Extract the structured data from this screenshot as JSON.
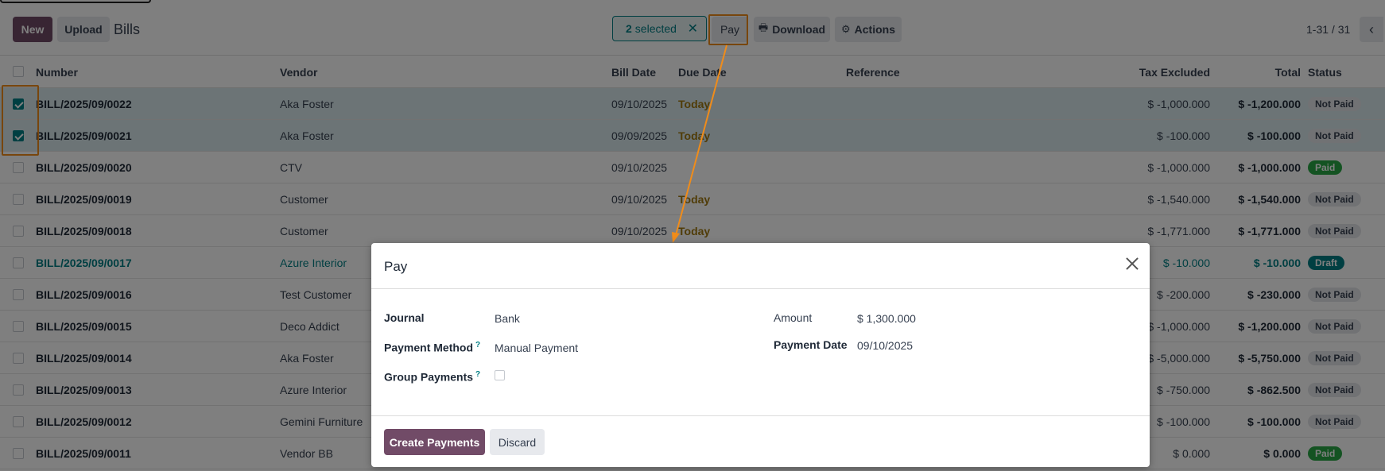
{
  "control_panel": {
    "new_label": "New",
    "upload_label": "Upload",
    "breadcrumb": "Bills",
    "selected_count": "2",
    "selected_text": "selected",
    "clear_icon": "close-icon",
    "pay_label": "Pay",
    "download_label": "Download",
    "download_icon": "printer-icon",
    "actions_label": "Actions",
    "actions_icon": "gear-icon",
    "pager": "1-31 / 31",
    "prev_icon": "chevron-left-icon"
  },
  "table": {
    "columns": [
      "Number",
      "Vendor",
      "Bill Date",
      "Due Date",
      "Reference",
      "Tax Excluded",
      "Total",
      "Status"
    ],
    "rows": [
      {
        "number": "BILL/2025/09/0022",
        "vendor": "Aka Foster",
        "bill_date": "09/10/2025",
        "due": "Today",
        "tax_excluded": "$ -1,000.000",
        "total": "$ -1,200.000",
        "status": "Not Paid",
        "status_type": "notpaid",
        "selected": true
      },
      {
        "number": "BILL/2025/09/0021",
        "vendor": "Aka Foster",
        "bill_date": "09/09/2025",
        "due": "Today",
        "tax_excluded": "$ -100.000",
        "total": "$ -100.000",
        "status": "Not Paid",
        "status_type": "notpaid",
        "selected": true
      },
      {
        "number": "BILL/2025/09/0020",
        "vendor": "CTV",
        "bill_date": "09/10/2025",
        "due": "",
        "tax_excluded": "$ -1,000.000",
        "total": "$ -1,000.000",
        "status": "Paid",
        "status_type": "paid",
        "selected": false
      },
      {
        "number": "BILL/2025/09/0019",
        "vendor": "Customer",
        "bill_date": "09/10/2025",
        "due": "Today",
        "tax_excluded": "$ -1,540.000",
        "total": "$ -1,540.000",
        "status": "Not Paid",
        "status_type": "notpaid",
        "selected": false
      },
      {
        "number": "BILL/2025/09/0018",
        "vendor": "Customer",
        "bill_date": "09/10/2025",
        "due": "Today",
        "tax_excluded": "$ -1,771.000",
        "total": "$ -1,771.000",
        "status": "Not Paid",
        "status_type": "notpaid",
        "selected": false
      },
      {
        "number": "BILL/2025/09/0017",
        "vendor": "Azure Interior",
        "bill_date": "",
        "due": "",
        "tax_excluded": "$ -10.000",
        "total": "$ -10.000",
        "status": "Draft",
        "status_type": "draft",
        "selected": false
      },
      {
        "number": "BILL/2025/09/0016",
        "vendor": "Test Customer",
        "bill_date": "",
        "due": "",
        "tax_excluded": "$ -200.000",
        "total": "$ -230.000",
        "status": "Not Paid",
        "status_type": "notpaid",
        "selected": false
      },
      {
        "number": "BILL/2025/09/0015",
        "vendor": "Deco Addict",
        "bill_date": "",
        "due": "",
        "tax_excluded": "$ -1,000.000",
        "total": "$ -1,200.000",
        "status": "Not Paid",
        "status_type": "notpaid",
        "selected": false
      },
      {
        "number": "BILL/2025/09/0014",
        "vendor": "Aka Foster",
        "bill_date": "",
        "due": "",
        "tax_excluded": "$ -5,000.000",
        "total": "$ -5,750.000",
        "status": "Not Paid",
        "status_type": "notpaid",
        "selected": false
      },
      {
        "number": "BILL/2025/09/0013",
        "vendor": "Azure Interior",
        "bill_date": "",
        "due": "",
        "tax_excluded": "$ -750.000",
        "total": "$ -862.500",
        "status": "Not Paid",
        "status_type": "notpaid",
        "selected": false
      },
      {
        "number": "BILL/2025/09/0012",
        "vendor": "Gemini Furniture",
        "bill_date": "",
        "due": "",
        "tax_excluded": "$ -100.000",
        "total": "$ -100.000",
        "status": "Not Paid",
        "status_type": "notpaid",
        "selected": false
      },
      {
        "number": "BILL/2025/09/0011",
        "vendor": "Vendor BB",
        "bill_date": "",
        "due": "",
        "tax_excluded": "$ 0.000",
        "total": "$ 0.000",
        "status": "Paid",
        "status_type": "paid",
        "selected": false
      }
    ]
  },
  "dialog": {
    "title": "Pay",
    "close_icon": "close-icon",
    "journal_label": "Journal",
    "journal_value": "Bank",
    "payment_method_label": "Payment Method",
    "payment_method_value": "Manual Payment",
    "group_payments_label": "Group Payments",
    "help_mark": "?",
    "amount_label": "Amount",
    "amount_value": "$ 1,300.000",
    "payment_date_label": "Payment Date",
    "payment_date_value": "09/10/2025",
    "create_label": "Create Payments",
    "discard_label": "Discard"
  },
  "colors": {
    "brand": "#714b67",
    "accent": "#017e84",
    "highlight": "#f08c1a",
    "due_today": "#a07810",
    "paid": "#28a745"
  }
}
